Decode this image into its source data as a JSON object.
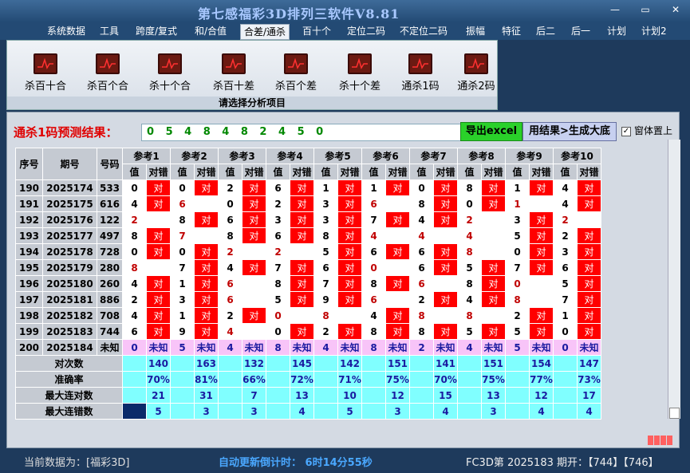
{
  "window": {
    "title": "第七感福彩3D排列三软件V8.81",
    "buttons": [
      "—",
      "▭",
      "✕"
    ]
  },
  "menu": [
    "系统数据",
    "工具",
    "跨度/复式",
    "和/合值",
    "合差/通杀",
    "百十个",
    "定位二码",
    "不定位二码",
    "振幅",
    "特征",
    "后二",
    "后一",
    "计划",
    "计划2"
  ],
  "active_menu": "合差/通杀",
  "ribbon": {
    "buttons": [
      "杀百十合",
      "杀百个合",
      "杀十个合",
      "杀百十差",
      "杀百个差",
      "杀十个差",
      "通杀1码",
      "通杀2码"
    ],
    "caption": "请选择分析项目"
  },
  "result": {
    "label": "通杀1码预测结果：",
    "value": "0 5 4 8 4 8 2 4 5 0",
    "excel_button": "导出excel",
    "gen_button": "用结果>生成大底",
    "topmost_label": "窗体置上",
    "topmost_checked": true
  },
  "table": {
    "headers": {
      "seq": "序号",
      "period": "期号",
      "code": "号码",
      "groups": [
        "参考1",
        "参考2",
        "参考3",
        "参考4",
        "参考5",
        "参考6",
        "参考7",
        "参考8",
        "参考9",
        "参考10"
      ],
      "val": "值",
      "judge": "对错"
    },
    "rows": [
      {
        "seq": "190",
        "period": "2025174",
        "code": "533",
        "cells": [
          [
            "0",
            "对"
          ],
          [
            "0",
            "对"
          ],
          [
            "2",
            "对"
          ],
          [
            "6",
            "对"
          ],
          [
            "1",
            "对"
          ],
          [
            "1",
            "对"
          ],
          [
            "0",
            "对"
          ],
          [
            "8",
            "对"
          ],
          [
            "1",
            "对"
          ],
          [
            "4",
            "对"
          ]
        ]
      },
      {
        "seq": "191",
        "period": "2025175",
        "code": "616",
        "cells": [
          [
            "4",
            "对"
          ],
          [
            "6",
            ""
          ],
          [
            "0",
            "对"
          ],
          [
            "2",
            "对"
          ],
          [
            "3",
            "对"
          ],
          [
            "6",
            ""
          ],
          [
            "8",
            "对"
          ],
          [
            "0",
            "对"
          ],
          [
            "1",
            ""
          ],
          [
            "4",
            "对"
          ]
        ]
      },
      {
        "seq": "192",
        "period": "2025176",
        "code": "122",
        "cells": [
          [
            "2",
            ""
          ],
          [
            "8",
            "对"
          ],
          [
            "6",
            "对"
          ],
          [
            "3",
            "对"
          ],
          [
            "3",
            "对"
          ],
          [
            "7",
            "对"
          ],
          [
            "4",
            "对"
          ],
          [
            "2",
            ""
          ],
          [
            "3",
            "对"
          ],
          [
            "2",
            ""
          ]
        ]
      },
      {
        "seq": "193",
        "period": "2025177",
        "code": "497",
        "cells": [
          [
            "8",
            "对"
          ],
          [
            "7",
            ""
          ],
          [
            "8",
            "对"
          ],
          [
            "6",
            "对"
          ],
          [
            "8",
            "对"
          ],
          [
            "4",
            ""
          ],
          [
            "4",
            ""
          ],
          [
            "4",
            ""
          ],
          [
            "5",
            "对"
          ],
          [
            "2",
            "对"
          ]
        ]
      },
      {
        "seq": "194",
        "period": "2025178",
        "code": "728",
        "cells": [
          [
            "0",
            "对"
          ],
          [
            "0",
            "对"
          ],
          [
            "2",
            ""
          ],
          [
            "2",
            ""
          ],
          [
            "5",
            "对"
          ],
          [
            "6",
            "对"
          ],
          [
            "6",
            "对"
          ],
          [
            "8",
            ""
          ],
          [
            "0",
            "对"
          ],
          [
            "3",
            "对"
          ]
        ]
      },
      {
        "seq": "195",
        "period": "2025179",
        "code": "280",
        "cells": [
          [
            "8",
            ""
          ],
          [
            "7",
            "对"
          ],
          [
            "4",
            "对"
          ],
          [
            "7",
            "对"
          ],
          [
            "6",
            "对"
          ],
          [
            "0",
            ""
          ],
          [
            "6",
            "对"
          ],
          [
            "5",
            "对"
          ],
          [
            "7",
            "对"
          ],
          [
            "6",
            "对"
          ]
        ]
      },
      {
        "seq": "196",
        "period": "2025180",
        "code": "260",
        "cells": [
          [
            "4",
            "对"
          ],
          [
            "1",
            "对"
          ],
          [
            "6",
            ""
          ],
          [
            "8",
            "对"
          ],
          [
            "7",
            "对"
          ],
          [
            "8",
            "对"
          ],
          [
            "6",
            ""
          ],
          [
            "8",
            "对"
          ],
          [
            "0",
            ""
          ],
          [
            "5",
            "对"
          ]
        ]
      },
      {
        "seq": "197",
        "period": "2025181",
        "code": "886",
        "cells": [
          [
            "2",
            "对"
          ],
          [
            "3",
            "对"
          ],
          [
            "6",
            ""
          ],
          [
            "5",
            "对"
          ],
          [
            "9",
            "对"
          ],
          [
            "6",
            ""
          ],
          [
            "2",
            "对"
          ],
          [
            "4",
            "对"
          ],
          [
            "8",
            ""
          ],
          [
            "7",
            "对"
          ]
        ]
      },
      {
        "seq": "198",
        "period": "2025182",
        "code": "708",
        "cells": [
          [
            "4",
            "对"
          ],
          [
            "1",
            "对"
          ],
          [
            "2",
            "对"
          ],
          [
            "0",
            ""
          ],
          [
            "8",
            ""
          ],
          [
            "4",
            "对"
          ],
          [
            "8",
            ""
          ],
          [
            "8",
            ""
          ],
          [
            "2",
            "对"
          ],
          [
            "1",
            "对"
          ]
        ]
      },
      {
        "seq": "199",
        "period": "2025183",
        "code": "744",
        "cells": [
          [
            "6",
            "对"
          ],
          [
            "9",
            "对"
          ],
          [
            "4",
            ""
          ],
          [
            "0",
            "对"
          ],
          [
            "2",
            "对"
          ],
          [
            "8",
            "对"
          ],
          [
            "8",
            "对"
          ],
          [
            "5",
            "对"
          ],
          [
            "5",
            "对"
          ],
          [
            "0",
            "对"
          ]
        ]
      }
    ],
    "pending": {
      "seq": "200",
      "period": "2025184",
      "code": "未知",
      "values": [
        "0",
        "5",
        "4",
        "8",
        "4",
        "8",
        "2",
        "4",
        "5",
        "0"
      ],
      "judge": "未知"
    },
    "stats": [
      {
        "label": "对次数",
        "values": [
          "140",
          "163",
          "132",
          "145",
          "142",
          "151",
          "141",
          "151",
          "154",
          "147"
        ]
      },
      {
        "label": "准确率",
        "values": [
          "70%",
          "81%",
          "66%",
          "72%",
          "71%",
          "75%",
          "70%",
          "75%",
          "77%",
          "73%"
        ]
      },
      {
        "label": "最大连对数",
        "values": [
          "21",
          "31",
          "7",
          "13",
          "10",
          "12",
          "15",
          "13",
          "12",
          "17"
        ]
      },
      {
        "label": "最大连错数",
        "values": [
          "5",
          "3",
          "3",
          "4",
          "5",
          "3",
          "4",
          "3",
          "4",
          "4"
        ]
      }
    ]
  },
  "status": {
    "data_source": "当前数据为：[福彩3D]",
    "countdown": "自动更新倒计时： 6时14分55秒",
    "latest": "FC3D第 2025183 期开：【744】【746】"
  },
  "colors": {
    "hit": "#ff0000",
    "pending": "#f8c4f8",
    "stats": "#80ffff",
    "header": "#c5cad2",
    "excel": "#2ad12a",
    "highlight_text": "#c00000"
  }
}
